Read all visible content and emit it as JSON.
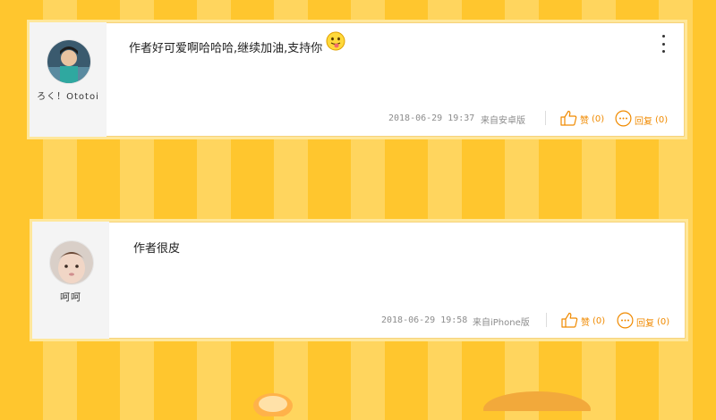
{
  "colors": {
    "accent": "#F08A00",
    "background_stripe_a": "#FFC62E",
    "background_stripe_b": "#FFD55E",
    "card_side": "#F4F4F4"
  },
  "comments": [
    {
      "username": "ろく！Ototoi",
      "text": "作者好可爱啊哈哈哈,继续加油,支持你",
      "emoji_icon": "tongue-out-face-emoji",
      "date": "2018-06-29 19:37",
      "source": "来自安卓版",
      "like_label": "赞",
      "like_count": "(0)",
      "reply_label": "回复",
      "reply_count": "(0)",
      "has_more_menu": true
    },
    {
      "username": "呵呵",
      "text": "作者很皮",
      "date": "2018-06-29 19:58",
      "source": "来自iPhone版",
      "like_label": "赞",
      "like_count": "(0)",
      "reply_label": "回复",
      "reply_count": "(0)",
      "has_more_menu": false
    }
  ]
}
